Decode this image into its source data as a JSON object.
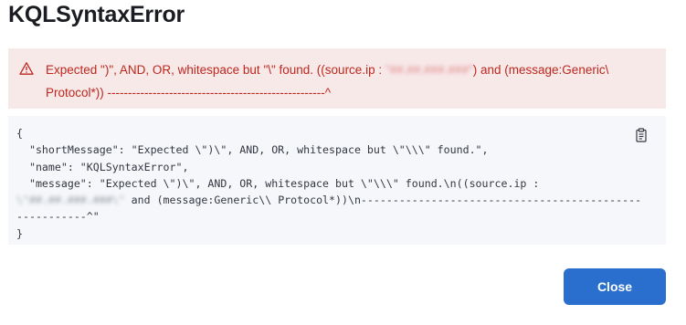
{
  "modal": {
    "title": "KQLSyntaxError",
    "error": {
      "icon": "warning-icon",
      "color": "#bd271e",
      "text_before": "Expected \")\", AND, OR, whitespace but \"\\\" found. ((source.ip : ",
      "redacted": "\"##.##.###.###\"",
      "text_after": ") and (message:Generic\\ Protocol*)) -----------------------------------------------------^"
    },
    "code": {
      "line1": "{",
      "line2": "  \"shortMessage\": \"Expected \\\")\\\", AND, OR, whitespace but \\\"\\\\\\\" found.\",",
      "line3": "  \"name\": \"KQLSyntaxError\",",
      "line4": "  \"message\": \"Expected \\\")\\\", AND, OR, whitespace but \\\"\\\\\\\" found.\\n((source.ip :",
      "line5_redacted": "\\\"##.##.###.###\\\"",
      "line5_rest": " and (message:Generic\\\\ Protocol*))\\n--------------------------------------------",
      "line6": "-----------^\"",
      "line7": "}",
      "copy_icon": "clipboard-icon"
    },
    "close_label": "Close",
    "accent_color": "#2a6fcd"
  }
}
